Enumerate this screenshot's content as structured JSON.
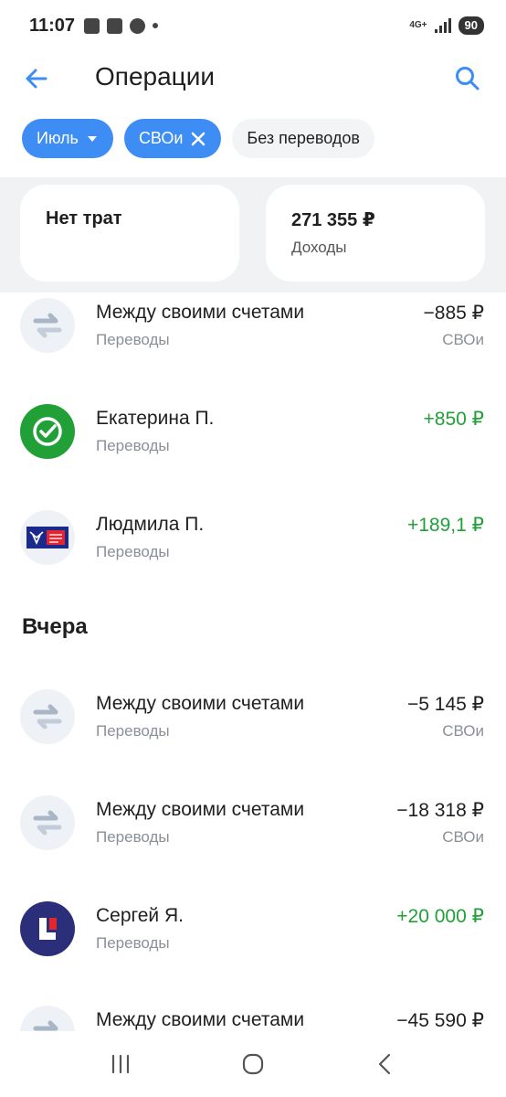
{
  "status_bar": {
    "time": "11:07",
    "network": "4G+",
    "battery": "90"
  },
  "header": {
    "title": "Операции",
    "back_icon": "arrow-left-icon",
    "search_icon": "search-icon"
  },
  "filters": [
    {
      "label": "Июль",
      "active": true,
      "icon": "caret-down-icon"
    },
    {
      "label": "СВОи",
      "active": true,
      "icon": "close-icon"
    },
    {
      "label": "Без переводов",
      "active": false
    }
  ],
  "summary": {
    "expenses_label": "Нет трат",
    "income_amount": "271 355 ₽",
    "income_label": "Доходы"
  },
  "transactions_today": [
    {
      "name": "Между своими счетами",
      "category": "Переводы",
      "amount": "−885 ₽",
      "account": "СВОи",
      "positive": false,
      "avatar": "transfer-icon"
    },
    {
      "name": "Екатерина П.",
      "category": "Переводы",
      "amount": "+850 ₽",
      "account": "",
      "positive": true,
      "avatar": "sber-logo-icon"
    },
    {
      "name": "Людмила П.",
      "category": "Переводы",
      "amount": "+189,1 ₽",
      "account": "",
      "positive": true,
      "avatar": "pochta-bank-logo-icon"
    }
  ],
  "section_yesterday": "Вчера",
  "transactions_yesterday": [
    {
      "name": "Между своими счетами",
      "category": "Переводы",
      "amount": "−5 145 ₽",
      "account": "СВОи",
      "positive": false,
      "avatar": "transfer-icon"
    },
    {
      "name": "Между своими счетами",
      "category": "Переводы",
      "amount": "−18 318 ₽",
      "account": "СВОи",
      "positive": false,
      "avatar": "transfer-icon"
    },
    {
      "name": "Сергей Я.",
      "category": "Переводы",
      "amount": "+20 000 ₽",
      "account": "",
      "positive": true,
      "avatar": "bank-logo-icon"
    },
    {
      "name": "Между своими счетами",
      "category": "",
      "amount": "−45 590 ₽",
      "account": "",
      "positive": false,
      "avatar": "transfer-icon"
    }
  ],
  "colors": {
    "accent": "#3d8df5",
    "positive": "#21a038",
    "muted": "#8a8f98"
  },
  "nav": {
    "recents_icon": "recents-icon",
    "home_icon": "home-icon",
    "back_icon": "nav-back-icon"
  }
}
